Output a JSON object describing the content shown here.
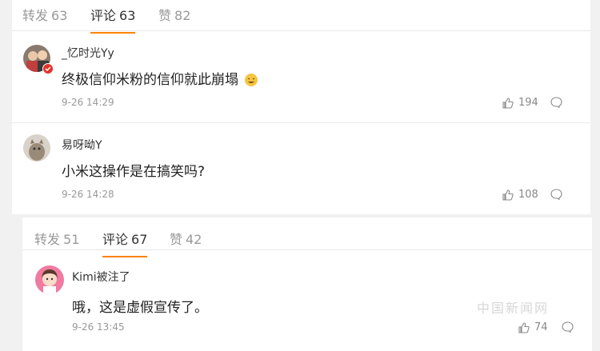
{
  "panel1": {
    "tabs": [
      {
        "label": "转发",
        "count": "63"
      },
      {
        "label": "评论",
        "count": "63"
      },
      {
        "label": "赞",
        "count": "82"
      }
    ],
    "comments": [
      {
        "user": "_忆时光Yy",
        "text": "终极信仰米粉的信仰就此崩塌",
        "time": "9-26 14:29",
        "likes": "194"
      },
      {
        "user": "易呀呦Y",
        "text": "小米这操作是在搞笑吗?",
        "time": "9-26 14:28",
        "likes": "108"
      }
    ]
  },
  "panel2": {
    "tabs": [
      {
        "label": "转发",
        "count": "51"
      },
      {
        "label": "评论",
        "count": "67"
      },
      {
        "label": "赞",
        "count": "42"
      }
    ],
    "comments": [
      {
        "user": "Kimi被注了",
        "text": "哦，这是虚假宣传了。",
        "time": "9-26 13:45",
        "likes": "74"
      }
    ]
  },
  "watermark": "中国新闻网"
}
